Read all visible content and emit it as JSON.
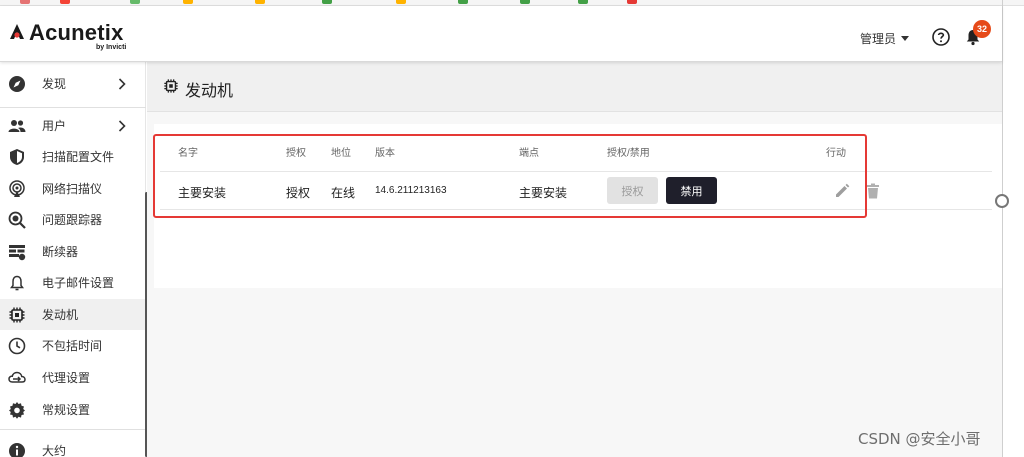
{
  "app": {
    "brand": "Acunetix",
    "brand_sub": "by Invicti"
  },
  "header": {
    "user_label": "管理员",
    "notification_count": "32"
  },
  "sidebar": {
    "items": [
      {
        "label": "发现",
        "icon": "compass-icon",
        "has_chevron": true
      },
      {
        "label": "用户",
        "icon": "users-icon",
        "has_chevron": true
      },
      {
        "label": "扫描配置文件",
        "icon": "shield-icon",
        "has_chevron": false
      },
      {
        "label": "网络扫描仪",
        "icon": "radar-icon",
        "has_chevron": false
      },
      {
        "label": "问题跟踪器",
        "icon": "bug-search-icon",
        "has_chevron": false
      },
      {
        "label": "断续器",
        "icon": "firewall-icon",
        "has_chevron": false
      },
      {
        "label": "电子邮件设置",
        "icon": "bell-icon",
        "has_chevron": false
      },
      {
        "label": "发动机",
        "icon": "chip-icon",
        "has_chevron": false,
        "active": true
      },
      {
        "label": "不包括时间",
        "icon": "clock-icon",
        "has_chevron": false
      },
      {
        "label": "代理设置",
        "icon": "proxy-icon",
        "has_chevron": false
      },
      {
        "label": "常规设置",
        "icon": "gear-icon",
        "has_chevron": false
      },
      {
        "label": "大约",
        "icon": "info-icon",
        "has_chevron": false
      }
    ]
  },
  "page": {
    "title": "发动机"
  },
  "table": {
    "columns": [
      "名字",
      "授权",
      "地位",
      "版本",
      "端点",
      "授权/禁用",
      "行动"
    ],
    "rows": [
      {
        "name": "主要安装",
        "authorization": "授权",
        "status": "在线",
        "version": "14.6.211213163",
        "endpoint": "主要安装",
        "authorize_button": "授权",
        "disable_button": "禁用"
      }
    ]
  },
  "watermark": "CSDN @安全小哥",
  "colors": {
    "accent_red": "#e53935",
    "badge": "#e64a19",
    "dark_button": "#1f1f2b"
  }
}
